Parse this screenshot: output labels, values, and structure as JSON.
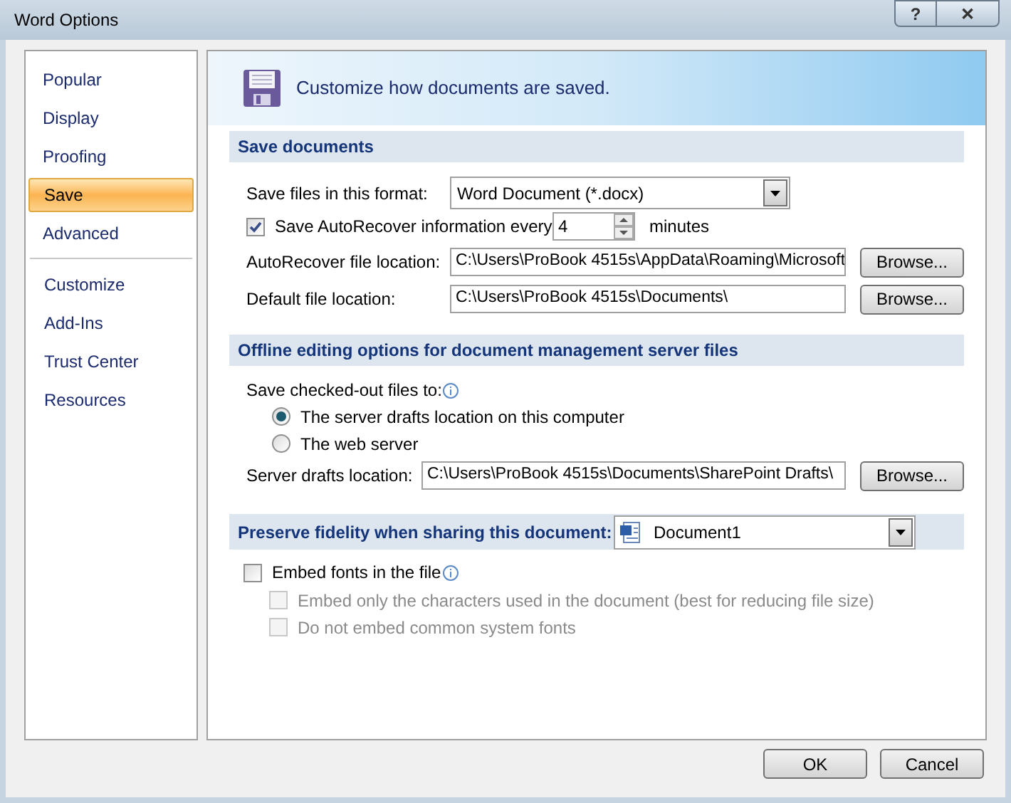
{
  "window": {
    "title": "Word Options",
    "help": "?",
    "close": "✕"
  },
  "sidebar": {
    "groups": [
      [
        {
          "label": "Popular",
          "selected": false
        },
        {
          "label": "Display",
          "selected": false
        },
        {
          "label": "Proofing",
          "selected": false
        },
        {
          "label": "Save",
          "selected": true
        },
        {
          "label": "Advanced",
          "selected": false
        }
      ],
      [
        {
          "label": "Customize",
          "selected": false
        },
        {
          "label": "Add-Ins",
          "selected": false
        },
        {
          "label": "Trust Center",
          "selected": false
        },
        {
          "label": "Resources",
          "selected": false
        }
      ]
    ]
  },
  "header": "Customize how documents are saved.",
  "save_documents": {
    "title": "Save documents",
    "format": {
      "label": "Save files in this format:",
      "value": "Word Document (*.docx)"
    },
    "autorecover": {
      "label": "Save AutoRecover information every",
      "checked": true,
      "value": "4",
      "unit": "minutes"
    },
    "locations": [
      {
        "label": "AutoRecover file location:",
        "value": "C:\\Users\\ProBook 4515s\\AppData\\Roaming\\Microsoft",
        "button": "Browse..."
      },
      {
        "label": "Default file location:",
        "value": "C:\\Users\\ProBook 4515s\\Documents\\",
        "button": "Browse..."
      }
    ]
  },
  "offline": {
    "title": "Offline editing options for document management server files",
    "save_to_label": "Save checked-out files to:",
    "options": [
      {
        "label": "The server drafts location on this computer",
        "selected": true
      },
      {
        "label": "The web server",
        "selected": false
      }
    ],
    "drafts_location": {
      "label": "Server drafts location:",
      "value": "C:\\Users\\ProBook 4515s\\Documents\\SharePoint Drafts\\",
      "button": "Browse..."
    }
  },
  "fidelity": {
    "title": "Preserve fidelity when sharing this document:",
    "document": "Document1",
    "embed": {
      "label": "Embed fonts in the file",
      "checked": false
    },
    "suboptions": [
      {
        "label": "Embed only the characters used in the document (best for reducing file size)",
        "checked": false,
        "disabled": true
      },
      {
        "label": "Do not embed common system fonts",
        "checked": false,
        "disabled": true
      }
    ]
  },
  "buttons": [
    "OK",
    "Cancel"
  ]
}
